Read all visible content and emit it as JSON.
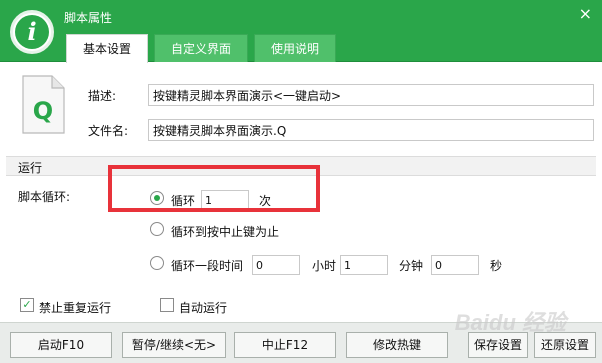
{
  "window": {
    "title": "脚本属性",
    "close": "×"
  },
  "tabs": [
    {
      "label": "基本设置",
      "active": true
    },
    {
      "label": "自定义界面",
      "active": false
    },
    {
      "label": "使用说明",
      "active": false
    }
  ],
  "file_icon_letter": "Q",
  "fields": {
    "desc_label": "描述:",
    "desc_value": "按键精灵脚本界面演示<一键启动>",
    "filename_label": "文件名:",
    "filename_value": "按键精灵脚本界面演示.Q"
  },
  "run_section": {
    "title": "运行",
    "loop_label": "脚本循环:",
    "options": [
      {
        "label": "循环",
        "checked": true,
        "count": "1",
        "unit": "次"
      },
      {
        "label": "循环到按中止键为止",
        "checked": false
      },
      {
        "label": "循环一段时间",
        "checked": false,
        "hours": "0",
        "hours_unit": "小时",
        "minutes": "1",
        "minutes_unit": "分钟",
        "seconds": "0",
        "seconds_unit": "秒"
      }
    ]
  },
  "checkboxes": [
    {
      "label": "禁止重复运行",
      "checked": true
    },
    {
      "label": "自动运行",
      "checked": false
    }
  ],
  "buttons": {
    "start": "启动F10",
    "pause": "暂停/继续<无>",
    "stop": "中止F12",
    "hotkey": "修改热键",
    "save": "保存设置",
    "restore": "还原设置"
  },
  "highlight_color": "#e8323a",
  "accent_color": "#2aa64a",
  "icons": [
    "info-logo-icon",
    "close-icon",
    "script-file-icon",
    "radio-icon",
    "checkbox-icon"
  ],
  "watermark": "Baidu 经验"
}
